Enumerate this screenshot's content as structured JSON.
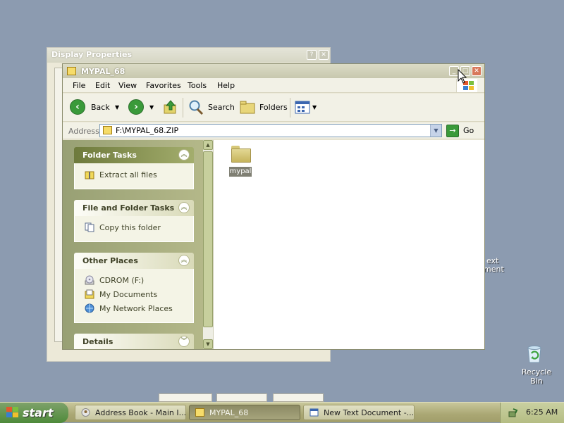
{
  "background_dialog": {
    "title": "Display Properties",
    "help_btn": "?",
    "close_btn": "✕"
  },
  "window": {
    "title": "MYPAL_68",
    "controls": {
      "minimize": "_",
      "maximize": "□",
      "close": "✕"
    },
    "menu": [
      "File",
      "Edit",
      "View",
      "Favorites",
      "Tools",
      "Help"
    ],
    "toolbar": {
      "back": "Back",
      "search": "Search",
      "folders": "Folders"
    },
    "address": {
      "label": "Address",
      "value": "F:\\MYPAL_68.ZIP",
      "go": "Go"
    },
    "task_pane": {
      "folder_tasks": {
        "title": "Folder Tasks",
        "items": [
          "Extract all files"
        ]
      },
      "file_folder_tasks": {
        "title": "File and Folder Tasks",
        "items": [
          "Copy this folder"
        ]
      },
      "other_places": {
        "title": "Other Places",
        "items": [
          "CDROM (F:)",
          "My Documents",
          "My Network Places"
        ]
      },
      "details": {
        "title": "Details"
      }
    },
    "files": [
      {
        "name": "mypal",
        "type": "folder",
        "selected": true
      }
    ]
  },
  "desktop": {
    "fragment_line1": "ext",
    "fragment_line2": "ment",
    "recycle_bin": "Recycle Bin"
  },
  "taskbar": {
    "start": "start",
    "tasks": [
      {
        "label": "Address Book - Main I...",
        "active": false
      },
      {
        "label": "MYPAL_68",
        "active": true
      },
      {
        "label": "New Text Document -...",
        "active": false
      }
    ],
    "clock": "6:25 AM"
  },
  "colors": {
    "desktop": "#8c9bb0",
    "taskpane": "#a8af7c",
    "accent_green": "#3a9a3a"
  }
}
